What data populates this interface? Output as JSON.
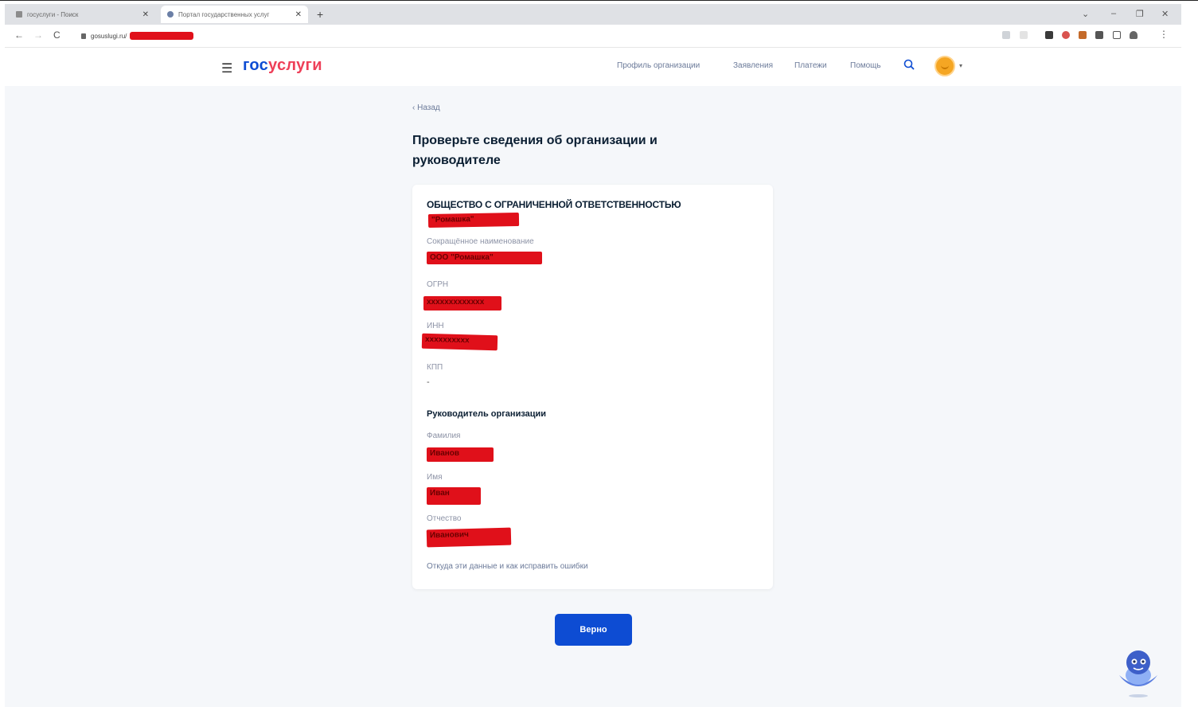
{
  "browser": {
    "tabs": [
      {
        "label": "госуслуги - Поиск",
        "active": false
      },
      {
        "label": "Портал государственных услуг",
        "active": true
      }
    ],
    "new_tab": "+",
    "address": "gosuslugi.ru/",
    "window_controls": [
      "⌄",
      "–",
      "❐",
      "✕"
    ],
    "nav": {
      "back": "←",
      "forward": "→",
      "reload": "C"
    }
  },
  "header": {
    "logo_part1": "гос",
    "logo_part2": "услуги",
    "menu": [
      "Профиль организации",
      "Заявления",
      "Платежи",
      "Помощь"
    ]
  },
  "back_link": "‹ Назад",
  "title": "Проверьте сведения об организации и руководителе",
  "organization": {
    "full_name": "ОБЩЕСТВО С ОГРАНИЧЕННОЙ ОТВЕТСТВЕННОСТЬЮ",
    "full_name_redacted": "\"Ромашка\"",
    "short_name_label": "Сокращённое наименование",
    "short_name_value": "ООО \"Ромашка\"",
    "ogrn_label": "ОГРН",
    "ogrn_value": "ххххххххххххх",
    "inn_label": "ИНН",
    "inn_value": "хххххххххх",
    "kpp_label": "КПП",
    "kpp_value": "-"
  },
  "head": {
    "section_title": "Руководитель организации",
    "surname_label": "Фамилия",
    "surname_value": "Иванов",
    "name_label": "Имя",
    "name_value": "Иван",
    "patronymic_label": "Отчество",
    "patronymic_value": "Иванович"
  },
  "help_link": "Откуда эти данные и как исправить ошибки",
  "confirm_button": "Верно",
  "colors": {
    "brand_blue": "#0d4cd3",
    "brand_red": "#ee3f58",
    "redaction": "#e0101a"
  }
}
